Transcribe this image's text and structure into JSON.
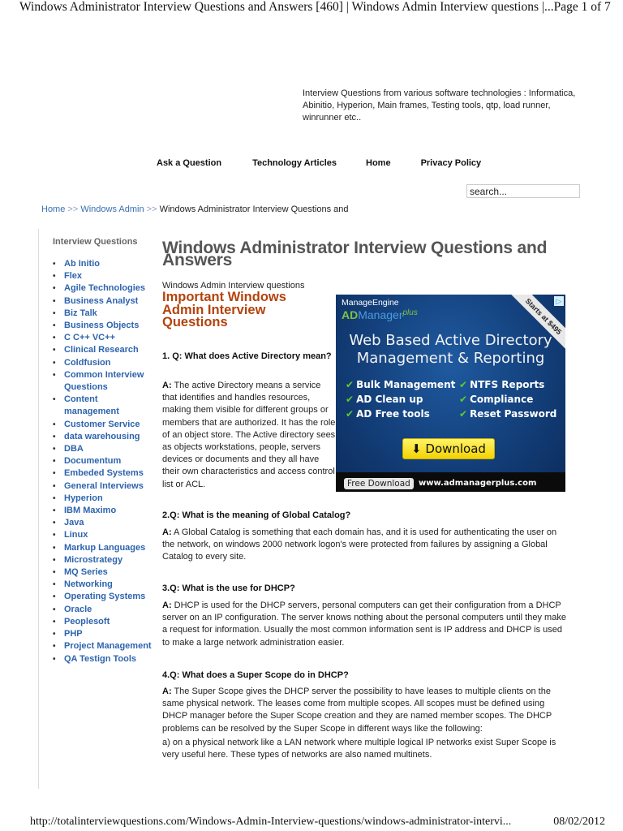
{
  "print_header": {
    "title": "Windows Administrator Interview Questions and Answers [460] | Windows Admin Interview questions |...",
    "page": "Page 1 of 7"
  },
  "print_footer": {
    "url": "http://totalinterviewquestions.com/Windows-Admin-Interview-questions/windows-administrator-intervi...",
    "date": "08/02/2012"
  },
  "tagline": "Interview Questions from various software technologies : Informatica, Abinitio, Hyperion, Main frames, Testing tools, qtp, load runner, winrunner etc..",
  "nav": [
    {
      "label": "Ask a Question"
    },
    {
      "label": "Technology Articles"
    },
    {
      "label": "Home"
    },
    {
      "label": "Privacy Policy"
    }
  ],
  "search": {
    "value": "search..."
  },
  "breadcrumb": {
    "items": [
      "Home",
      "Windows Admin",
      "Windows Administrator Interview Questions and"
    ],
    "separator": ">>"
  },
  "sidebar": {
    "title": "Interview Questions",
    "items": [
      "Ab Initio",
      "Flex",
      "Agile Technologies",
      "Business Analyst",
      "Biz Talk",
      "Business Objects",
      "C C++ VC++",
      "Clinical Research",
      "Coldfusion",
      "Common Interview Questions",
      "Content management",
      "Customer Service",
      "data warehousing",
      "DBA",
      "Documentum",
      "Embeded Systems",
      "General Interviews",
      "Hyperion",
      "IBM Maximo",
      "Java",
      "Linux",
      "Markup Languages",
      "Microstrategy",
      "MQ Series",
      "Networking",
      "Operating Systems",
      "Oracle",
      "Peoplesoft",
      "PHP",
      "Project Management",
      "QA Testign Tools"
    ]
  },
  "main": {
    "title": "Windows Administrator Interview Questions and Answers",
    "category": "Windows Admin Interview questions",
    "heading": "Important Windows Admin Interview Questions",
    "answer_prefix": "A:",
    "qa": [
      {
        "q": "1. Q: What does Active Directory mean?",
        "a": " The active Directory means a service that identifies and handles resources, making them visible for different groups or members that are authorized. It has the role of an object store. The Active directory sees as objects workstations, people, servers devices or documents and they all have their own characteristics and access control list or ACL."
      },
      {
        "q": "2.Q: What is the meaning of Global Catalog?",
        "a": " A Global Catalog is something that each domain has, and it is used for authenticating the user on the network, on windows 2000 network logon's were protected from failures by assigning a Global Catalog to every site."
      },
      {
        "q": "3.Q: What is the use for DHCP?",
        "a": " DHCP is used for the DHCP servers, personal computers can get their configuration from a DHCP server on an IP configuration. The server knows nothing about the personal computers until they make a request for information. Usually the most common information sent is IP address and DHCP is used to make a large network administration easier."
      },
      {
        "q": "4.Q: What does a Super Scope do in DHCP?",
        "a": " The Super Scope gives the DHCP server the possibility to have leases to multiple clients on the same physical network. The leases come from multiple scopes. All scopes must be defined using DHCP manager before the Super Scope creation and they are named member scopes. The DHCP problems can be resolved by the Super Scope in different ways like the following:",
        "extra": "a) on a physical network like a LAN network where multiple logical IP networks exist Super Scope is very useful here. These types of networks are also named multinets."
      }
    ]
  },
  "ad": {
    "brand_top": "ManageEngine",
    "brand_ad": "AD",
    "brand_manager": "Manager",
    "brand_plus": "plus",
    "ribbon": "Starts at $495",
    "headline_1": "Web Based Active Directory",
    "headline_2": "Management & Reporting",
    "features": [
      "Bulk Management",
      "NTFS Reports",
      "AD Clean up",
      "Compliance",
      "AD Free tools",
      "Reset Password"
    ],
    "download_label": "Download",
    "free_download_label": "Free Download",
    "url": "www.admanagerplus.com",
    "colors": {
      "background": "#133f7a",
      "brand_green": "#7fc241",
      "check": "#5ecb2f",
      "button": "#f4d300"
    }
  },
  "colors": {
    "link": "#2d64ad",
    "heading_accent": "#b3430c",
    "title": "#555555"
  }
}
